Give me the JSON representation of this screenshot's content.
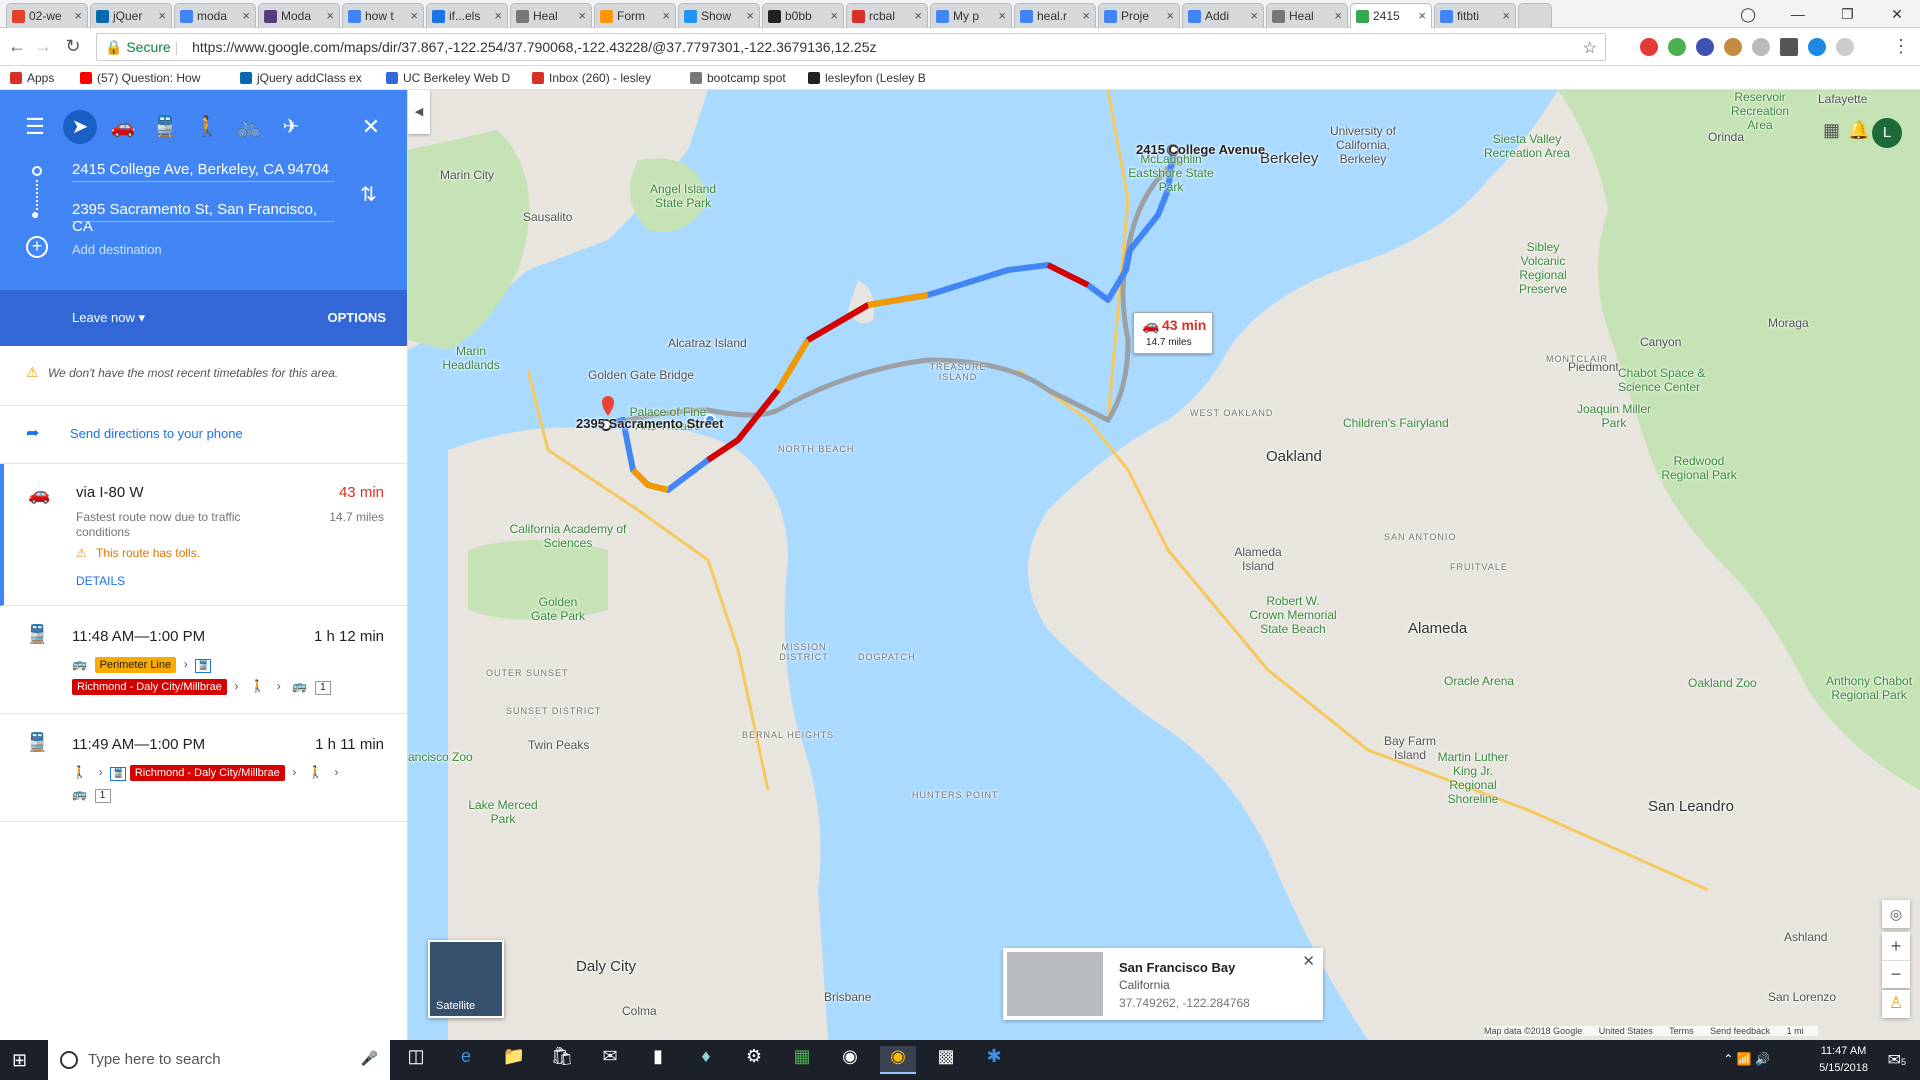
{
  "browser": {
    "tabs": [
      {
        "label": "02-we",
        "favicon_color": "#e24329"
      },
      {
        "label": "jQuer",
        "favicon_color": "#0769ad"
      },
      {
        "label": "moda",
        "favicon_color": "#4285f4"
      },
      {
        "label": "Moda",
        "favicon_color": "#563d7c"
      },
      {
        "label": "how t",
        "favicon_color": "#4285f4"
      },
      {
        "label": "if...els",
        "favicon_color": "#1a73e8"
      },
      {
        "label": "Heal",
        "favicon_color": "#777777"
      },
      {
        "label": "Form",
        "favicon_color": "#ff9800"
      },
      {
        "label": "Show",
        "favicon_color": "#2196f3"
      },
      {
        "label": "b0bb",
        "favicon_color": "#222222"
      },
      {
        "label": "rcbal",
        "favicon_color": "#d93025"
      },
      {
        "label": "My p",
        "favicon_color": "#4285f4"
      },
      {
        "label": "heal.r",
        "favicon_color": "#4285f4"
      },
      {
        "label": "Proje",
        "favicon_color": "#4285f4"
      },
      {
        "label": "Addi",
        "favicon_color": "#4285f4"
      },
      {
        "label": "Heal",
        "favicon_color": "#777777"
      },
      {
        "label": "2415",
        "favicon_color": "#34a853",
        "active": true
      },
      {
        "label": "fitbti",
        "favicon_color": "#4285f4"
      }
    ],
    "secure_label": "Secure",
    "url": "https://www.google.com/maps/dir/37.867,-122.254/37.790068,-122.43228/@37.7797301,-122.3679136,12.25z",
    "bookmarks": [
      {
        "label": "Apps",
        "color": "#d93025"
      },
      {
        "label": "(57) Question: How",
        "color": "#ff0000"
      },
      {
        "label": "jQuery addClass ex",
        "color": "#0769ad"
      },
      {
        "label": "UC Berkeley Web D",
        "color": "#3367d6"
      },
      {
        "label": "Inbox (260) - lesley",
        "color": "#d93025"
      },
      {
        "label": "bootcamp spot",
        "color": "#777777"
      },
      {
        "label": "lesleyfon (Lesley B",
        "color": "#222222"
      }
    ]
  },
  "directions": {
    "origin": "2415 College Ave, Berkeley, CA 94704",
    "destination": "2395 Sacramento St, San Francisco, CA",
    "add_destination": "Add destination",
    "leave_now": "Leave now",
    "options": "OPTIONS",
    "timetable_warning": "We don't have the most recent timetables for this area.",
    "send_to_phone": "Send directions to your phone",
    "routes": [
      {
        "title": "via I-80 W",
        "time": "43 min",
        "subtitle": "Fastest route now due to traffic conditions",
        "distance": "14.7 miles",
        "toll_note": "This route has tolls.",
        "details": "DETAILS"
      },
      {
        "title": "11:48 AM—1:00 PM",
        "time": "1 h 12 min",
        "line1": "Perimeter Line",
        "line2": "Richmond - Daly City/Millbrae",
        "count": "1"
      },
      {
        "title": "11:49 AM—1:00 PM",
        "time": "1 h 11 min",
        "line": "Richmond - Daly City/Millbrae",
        "count": "1"
      }
    ]
  },
  "map": {
    "route_box": {
      "time": "43 min",
      "distance": "14.7 miles"
    },
    "origin_label": "2415 College Avenue",
    "destination_label": "2395 Sacramento Street",
    "labels": {
      "berkeley": "Berkeley",
      "oakland": "Oakland",
      "alameda": "Alameda",
      "alameda_island": "Alameda Island",
      "daly_city": "Daly City",
      "san_leandro": "San Leandro",
      "piedmont": "Piedmont",
      "sausalito": "Sausalito",
      "marin_city": "Marin City",
      "angel_island": "Angel Island State Park",
      "alcatraz": "Alcatraz Island",
      "golden_gate_bridge": "Golden Gate Bridge",
      "twin_peaks": "Twin Peaks",
      "golden_gate_park": "Golden Gate Park",
      "palace": "Palace of Fine Arts Theatre",
      "cal_academy": "California Academy of Sciences",
      "moraga": "Moraga",
      "orinda": "Orinda",
      "lafayette": "Lafayette",
      "canyon": "Canyon",
      "childrens_fairyland": "Children's Fairyland",
      "chabot_space": "Chabot Space & Science Center",
      "oakland_zoo": "Oakland Zoo",
      "oracle_arena": "Oracle Arena",
      "bay_farm": "Bay Farm Island",
      "brisbane": "Brisbane",
      "colma": "Colma",
      "ashland": "Ashland",
      "san_lorenzo": "San Lorenzo",
      "treasure_island": "TREASURE ISLAND",
      "mission": "MISSION DISTRICT",
      "dogpatch": "DOGPATCH",
      "hunters_point": "HUNTERS POINT",
      "sunset": "SUNSET DISTRICT",
      "outer_sunset": "OUTER SUNSET",
      "bernal": "BERNAL HEIGHTS",
      "north_beach": "NORTH BEACH",
      "fruitvale": "FRUITVALE",
      "san_antonio": "SAN ANTONIO",
      "west_oakland": "WEST OAKLAND",
      "montclair": "MONTCLAIR",
      "uc": "University of California, Berkeley",
      "redwood": "Redwood Regional Park",
      "reservoir": "Reservoir Recreation Area",
      "siesta": "Siesta Valley Recreation Area",
      "sibley": "Sibley Volcanic Regional Preserve",
      "joaquin": "Joaquin Miller Park",
      "mclaughlin": "McLaughlin Eastshore State Park",
      "marin_headlands": "Marin Headlands",
      "robert_crown": "Robert W. Crown Memorial State Beach",
      "mlk": "Martin Luther King Jr. Regional Shoreline",
      "anthony_chabot": "Anthony Chabot Regional Park",
      "lake_merced": "Lake Merced Park",
      "zoo": "ancisco Zoo"
    },
    "satellite_label": "Satellite",
    "info_card": {
      "name": "San Francisco Bay",
      "state": "California",
      "coords": "37.749262, -122.284768"
    },
    "footer": {
      "data": "Map data ©2018 Google",
      "country": "United States",
      "terms": "Terms",
      "feedback": "Send feedback",
      "scale": "1 mi"
    },
    "avatar_letter": "L"
  },
  "taskbar": {
    "search_placeholder": "Type here to search",
    "time": "11:47 AM",
    "date": "5/15/2018",
    "notification_count": "5"
  }
}
